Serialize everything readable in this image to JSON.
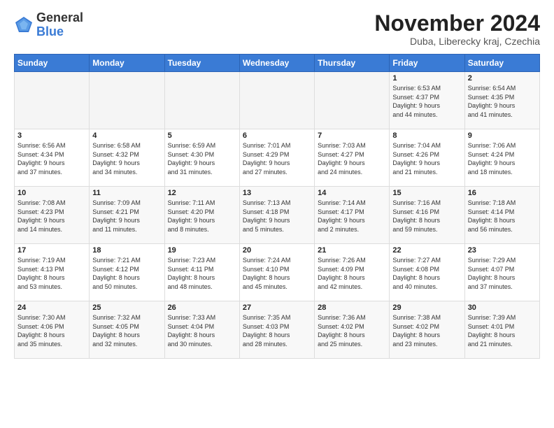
{
  "header": {
    "logo_general": "General",
    "logo_blue": "Blue",
    "month_title": "November 2024",
    "location": "Duba, Liberecky kraj, Czechia"
  },
  "days_of_week": [
    "Sunday",
    "Monday",
    "Tuesday",
    "Wednesday",
    "Thursday",
    "Friday",
    "Saturday"
  ],
  "weeks": [
    [
      {
        "day": "",
        "info": ""
      },
      {
        "day": "",
        "info": ""
      },
      {
        "day": "",
        "info": ""
      },
      {
        "day": "",
        "info": ""
      },
      {
        "day": "",
        "info": ""
      },
      {
        "day": "1",
        "info": "Sunrise: 6:53 AM\nSunset: 4:37 PM\nDaylight: 9 hours\nand 44 minutes."
      },
      {
        "day": "2",
        "info": "Sunrise: 6:54 AM\nSunset: 4:35 PM\nDaylight: 9 hours\nand 41 minutes."
      }
    ],
    [
      {
        "day": "3",
        "info": "Sunrise: 6:56 AM\nSunset: 4:34 PM\nDaylight: 9 hours\nand 37 minutes."
      },
      {
        "day": "4",
        "info": "Sunrise: 6:58 AM\nSunset: 4:32 PM\nDaylight: 9 hours\nand 34 minutes."
      },
      {
        "day": "5",
        "info": "Sunrise: 6:59 AM\nSunset: 4:30 PM\nDaylight: 9 hours\nand 31 minutes."
      },
      {
        "day": "6",
        "info": "Sunrise: 7:01 AM\nSunset: 4:29 PM\nDaylight: 9 hours\nand 27 minutes."
      },
      {
        "day": "7",
        "info": "Sunrise: 7:03 AM\nSunset: 4:27 PM\nDaylight: 9 hours\nand 24 minutes."
      },
      {
        "day": "8",
        "info": "Sunrise: 7:04 AM\nSunset: 4:26 PM\nDaylight: 9 hours\nand 21 minutes."
      },
      {
        "day": "9",
        "info": "Sunrise: 7:06 AM\nSunset: 4:24 PM\nDaylight: 9 hours\nand 18 minutes."
      }
    ],
    [
      {
        "day": "10",
        "info": "Sunrise: 7:08 AM\nSunset: 4:23 PM\nDaylight: 9 hours\nand 14 minutes."
      },
      {
        "day": "11",
        "info": "Sunrise: 7:09 AM\nSunset: 4:21 PM\nDaylight: 9 hours\nand 11 minutes."
      },
      {
        "day": "12",
        "info": "Sunrise: 7:11 AM\nSunset: 4:20 PM\nDaylight: 9 hours\nand 8 minutes."
      },
      {
        "day": "13",
        "info": "Sunrise: 7:13 AM\nSunset: 4:18 PM\nDaylight: 9 hours\nand 5 minutes."
      },
      {
        "day": "14",
        "info": "Sunrise: 7:14 AM\nSunset: 4:17 PM\nDaylight: 9 hours\nand 2 minutes."
      },
      {
        "day": "15",
        "info": "Sunrise: 7:16 AM\nSunset: 4:16 PM\nDaylight: 8 hours\nand 59 minutes."
      },
      {
        "day": "16",
        "info": "Sunrise: 7:18 AM\nSunset: 4:14 PM\nDaylight: 8 hours\nand 56 minutes."
      }
    ],
    [
      {
        "day": "17",
        "info": "Sunrise: 7:19 AM\nSunset: 4:13 PM\nDaylight: 8 hours\nand 53 minutes."
      },
      {
        "day": "18",
        "info": "Sunrise: 7:21 AM\nSunset: 4:12 PM\nDaylight: 8 hours\nand 50 minutes."
      },
      {
        "day": "19",
        "info": "Sunrise: 7:23 AM\nSunset: 4:11 PM\nDaylight: 8 hours\nand 48 minutes."
      },
      {
        "day": "20",
        "info": "Sunrise: 7:24 AM\nSunset: 4:10 PM\nDaylight: 8 hours\nand 45 minutes."
      },
      {
        "day": "21",
        "info": "Sunrise: 7:26 AM\nSunset: 4:09 PM\nDaylight: 8 hours\nand 42 minutes."
      },
      {
        "day": "22",
        "info": "Sunrise: 7:27 AM\nSunset: 4:08 PM\nDaylight: 8 hours\nand 40 minutes."
      },
      {
        "day": "23",
        "info": "Sunrise: 7:29 AM\nSunset: 4:07 PM\nDaylight: 8 hours\nand 37 minutes."
      }
    ],
    [
      {
        "day": "24",
        "info": "Sunrise: 7:30 AM\nSunset: 4:06 PM\nDaylight: 8 hours\nand 35 minutes."
      },
      {
        "day": "25",
        "info": "Sunrise: 7:32 AM\nSunset: 4:05 PM\nDaylight: 8 hours\nand 32 minutes."
      },
      {
        "day": "26",
        "info": "Sunrise: 7:33 AM\nSunset: 4:04 PM\nDaylight: 8 hours\nand 30 minutes."
      },
      {
        "day": "27",
        "info": "Sunrise: 7:35 AM\nSunset: 4:03 PM\nDaylight: 8 hours\nand 28 minutes."
      },
      {
        "day": "28",
        "info": "Sunrise: 7:36 AM\nSunset: 4:02 PM\nDaylight: 8 hours\nand 25 minutes."
      },
      {
        "day": "29",
        "info": "Sunrise: 7:38 AM\nSunset: 4:02 PM\nDaylight: 8 hours\nand 23 minutes."
      },
      {
        "day": "30",
        "info": "Sunrise: 7:39 AM\nSunset: 4:01 PM\nDaylight: 8 hours\nand 21 minutes."
      }
    ]
  ]
}
